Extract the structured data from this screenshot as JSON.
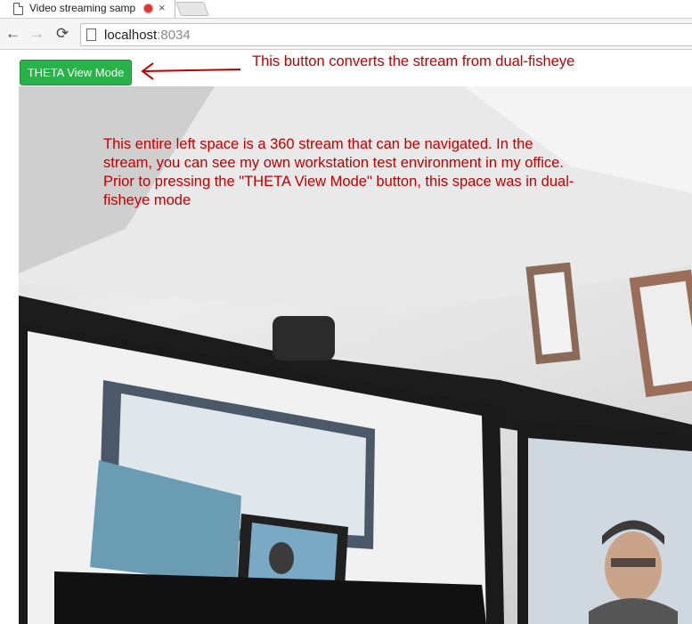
{
  "browser": {
    "tab_title": "Video streaming samp",
    "tab_close_glyph": "×",
    "nav": {
      "back_glyph": "←",
      "forward_glyph": "→",
      "reload_glyph": "⟳"
    },
    "address": {
      "host": "localhost",
      "port": ":8034"
    }
  },
  "toolbar": {
    "theta_button_label": "THETA View Mode"
  },
  "annotations": {
    "button_note": "This button converts the stream from dual-fisheye",
    "stream_note": "This entire left space is a 360 stream that can be navigated. In the stream, you can see my own workstation test environment in my office. Prior to pressing the \"THETA View Mode\" button, this space was in dual-fisheye mode",
    "color": "#c00000"
  },
  "colors": {
    "button_green": "#2ab24a",
    "recording_dot": "#dd3333"
  },
  "icons": [
    "page-icon",
    "recording-icon",
    "close-icon",
    "back-arrow-icon",
    "forward-arrow-icon",
    "reload-icon",
    "annotation-arrow-icon"
  ]
}
